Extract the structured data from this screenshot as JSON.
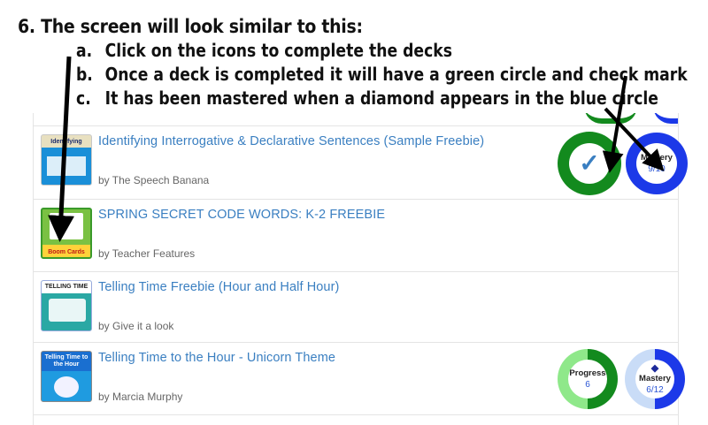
{
  "instructions": {
    "heading": "6.  The screen will look similar to this:",
    "items": [
      {
        "marker": "a.",
        "text": "Click on the icons to complete the decks"
      },
      {
        "marker": "b.",
        "text": "Once a deck is completed it will have a green circle and check mark"
      },
      {
        "marker": "c.",
        "text": "It has been mastered when a diamond appears in the blue circle"
      }
    ]
  },
  "decks": [
    {
      "title": "Identifying Interrogative & Declarative Sentences (Sample Freebie)",
      "author": "by The Speech Banana",
      "thumb_text": "Identifying",
      "status": "completed",
      "mastery_label": "Mastery",
      "mastery_value": "9/10"
    },
    {
      "title": "SPRING SECRET CODE WORDS: K-2 FREEBIE",
      "author": "by Teacher Features",
      "thumb_text": "Boom Cards"
    },
    {
      "title": "Telling Time Freebie (Hour and Half Hour)",
      "author": "by Give it a look",
      "thumb_text": "TELLING TIME"
    },
    {
      "title": "Telling Time to the Hour - Unicorn Theme",
      "author": "by Marcia Murphy",
      "thumb_text": "Telling Time to the Hour",
      "progress_label": "Progress",
      "progress_value": "6",
      "progress_fraction": 0.5,
      "mastery_label": "Mastery",
      "mastery_value": "6/12",
      "mastery_fraction": 0.5
    }
  ],
  "colors": {
    "complete_green": "#138a1e",
    "progress_light_green": "#8fe88a",
    "mastery_blue": "#1c39e8",
    "mastery_light_blue": "#c9dcf7",
    "link_blue": "#3a7fc1"
  },
  "icons": [
    "check-icon",
    "diamond-icon",
    "arrow-icon"
  ]
}
